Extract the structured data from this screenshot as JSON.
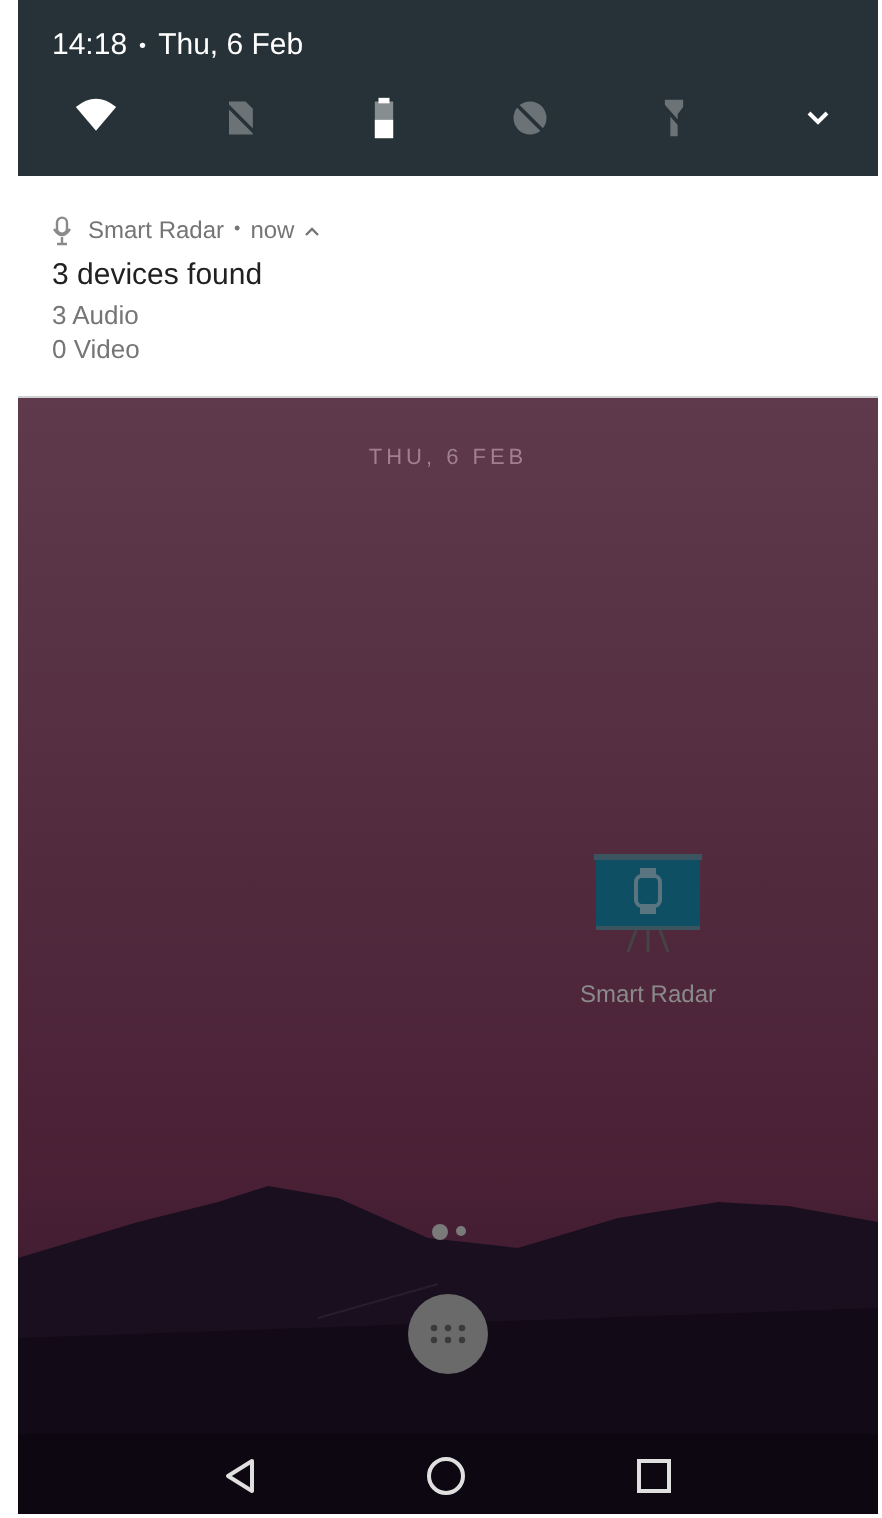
{
  "status_bar": {
    "time": "14:18",
    "separator": "•",
    "date": "Thu, 6 Feb"
  },
  "quick_settings": [
    {
      "kind": "wifi",
      "on": true
    },
    {
      "kind": "sim",
      "on": false
    },
    {
      "kind": "battery",
      "on": true
    },
    {
      "kind": "crossed-circle",
      "on": false
    },
    {
      "kind": "flashlight",
      "on": false
    }
  ],
  "notification": {
    "app": "Smart Radar",
    "separator": "•",
    "time": "now",
    "expanded": true,
    "title": "3 devices found",
    "lines": [
      "3 Audio",
      "0 Video"
    ]
  },
  "home": {
    "date": "THU, 6 FEB",
    "apps": [
      {
        "label": "Smart Radar"
      }
    ],
    "pages": [
      {
        "selected": true
      },
      {
        "selected": false
      }
    ]
  }
}
